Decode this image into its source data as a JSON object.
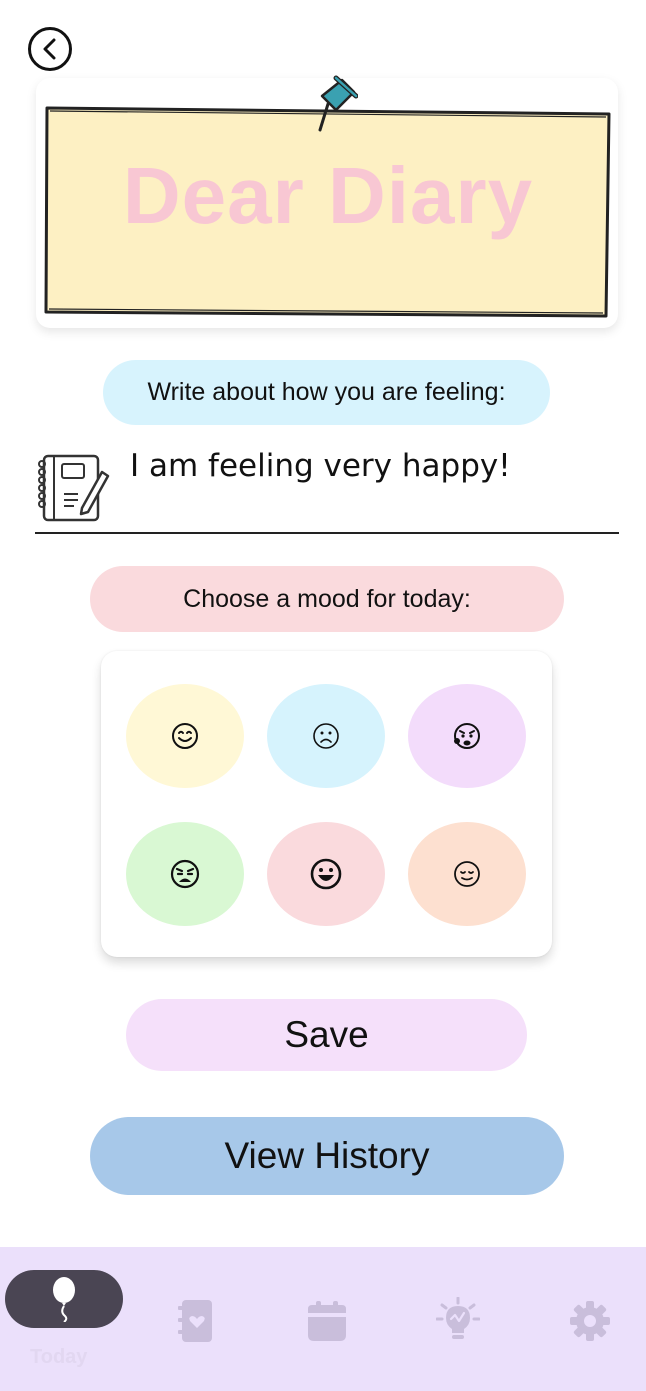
{
  "header": {
    "title": "Dear Diary"
  },
  "prompt": {
    "label": "Write about how you are feeling:",
    "entry_text": "I am feeling very happy!"
  },
  "mood_section": {
    "label": "Choose a mood for today:",
    "moods": [
      {
        "icon": "smiling-face-icon",
        "color": "#fff8d6"
      },
      {
        "icon": "sad-face-icon",
        "color": "#d6f3fd"
      },
      {
        "icon": "anxious-face-icon",
        "color": "#f3dcfb"
      },
      {
        "icon": "tired-face-icon",
        "color": "#d9f8d3"
      },
      {
        "icon": "grinning-face-icon",
        "color": "#fadadd"
      },
      {
        "icon": "calm-face-icon",
        "color": "#fde0d0"
      }
    ]
  },
  "buttons": {
    "save_label": "Save",
    "history_label": "View History"
  },
  "nav": {
    "active_label": "Today",
    "items": [
      {
        "icon": "balloon-icon",
        "label": "Today",
        "active": true
      },
      {
        "icon": "journal-heart-icon"
      },
      {
        "icon": "calendar-icon"
      },
      {
        "icon": "lightbulb-icon"
      },
      {
        "icon": "gear-icon"
      }
    ],
    "colors": {
      "background": "#ebe0fb",
      "active_pill": "#4a4553",
      "inactive_icon": "#c9bedb"
    }
  }
}
